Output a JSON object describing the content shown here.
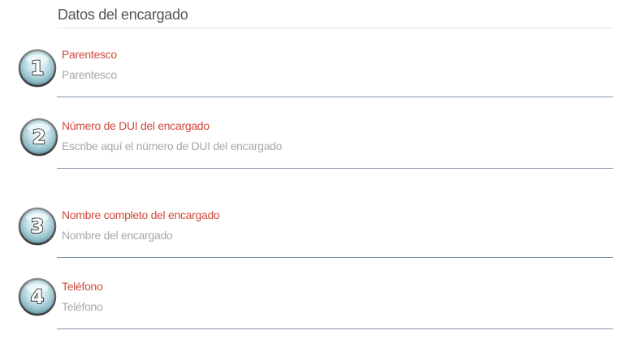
{
  "section": {
    "title": "Datos del encargado"
  },
  "fields": [
    {
      "step": "1",
      "label": "Parentesco",
      "value": "",
      "placeholder": "Parentesco"
    },
    {
      "step": "2",
      "label": "Número de DUI del encargado",
      "value": "",
      "placeholder": "Escribe aquí el número de DUI del encargado"
    },
    {
      "step": "3",
      "label": "Nombre completo del encargado",
      "value": "",
      "placeholder": "Nombre del encargado"
    },
    {
      "step": "4",
      "label": "Teléfono",
      "value": "",
      "placeholder": "Teléfono"
    }
  ],
  "colors": {
    "label": "#cf4a3e",
    "underline": "#8292a8",
    "placeholder": "#a8a8a8",
    "badge_glass": "#9fcfd8"
  },
  "icons": {
    "step_badge": "numbered-glass-circle-icon"
  }
}
